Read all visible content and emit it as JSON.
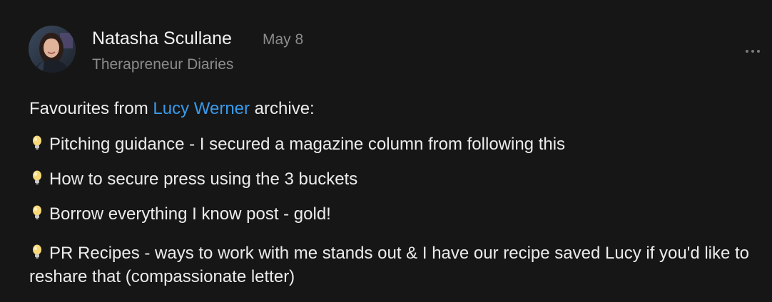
{
  "post": {
    "author": "Natasha Scullane",
    "date": "May 8",
    "publication": "Therapreneur Diaries",
    "intro_before": "Favourites from ",
    "mention": "Lucy Werner",
    "intro_after": " archive:",
    "bullet_icon": "lightbulb-icon",
    "items": [
      "Pitching guidance - I secured a magazine column from following this",
      "How to secure press using the 3 buckets",
      "Borrow everything I know post - gold!",
      "PR Recipes - ways to work with me stands out & I have our recipe saved Lucy if you'd like to reshare that (compassionate letter)"
    ]
  },
  "colors": {
    "background": "#161616",
    "text": "#ececec",
    "muted": "#8b8b8b",
    "mention": "#3a9ae9"
  }
}
